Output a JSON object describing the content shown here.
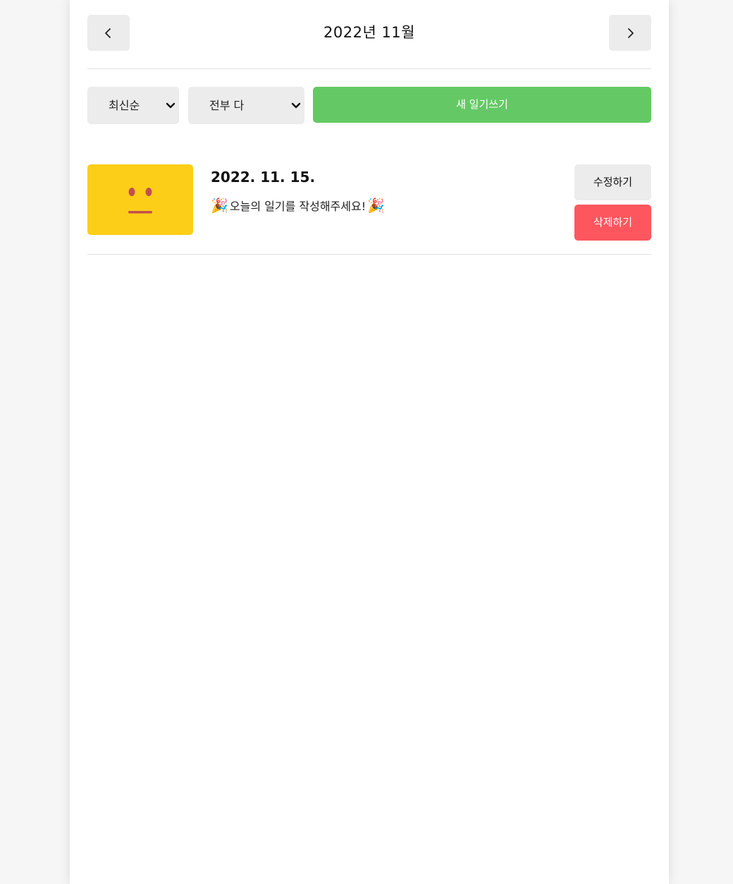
{
  "header": {
    "title": "2022년 11월",
    "prev_icon": "chevron-left-icon",
    "next_icon": "chevron-right-icon"
  },
  "menu": {
    "sort_selected": "최신순",
    "filter_selected": "전부 다",
    "new_button_label": "새 일기쓰기"
  },
  "diary_list": [
    {
      "date": "2022. 11. 15.",
      "content": "오늘의 일기를 작성해주세요!",
      "emotion_icon": "neutral-face-icon",
      "emotion_color": "#fdce17",
      "content_icon": "party-popper-icon",
      "edit_label": "수정하기",
      "delete_label": "삭제하기"
    }
  ],
  "colors": {
    "new_button": "#64c964",
    "delete_button": "#fd565f",
    "neutral_button": "#ececec",
    "emotion_yellow": "#fdce17"
  }
}
